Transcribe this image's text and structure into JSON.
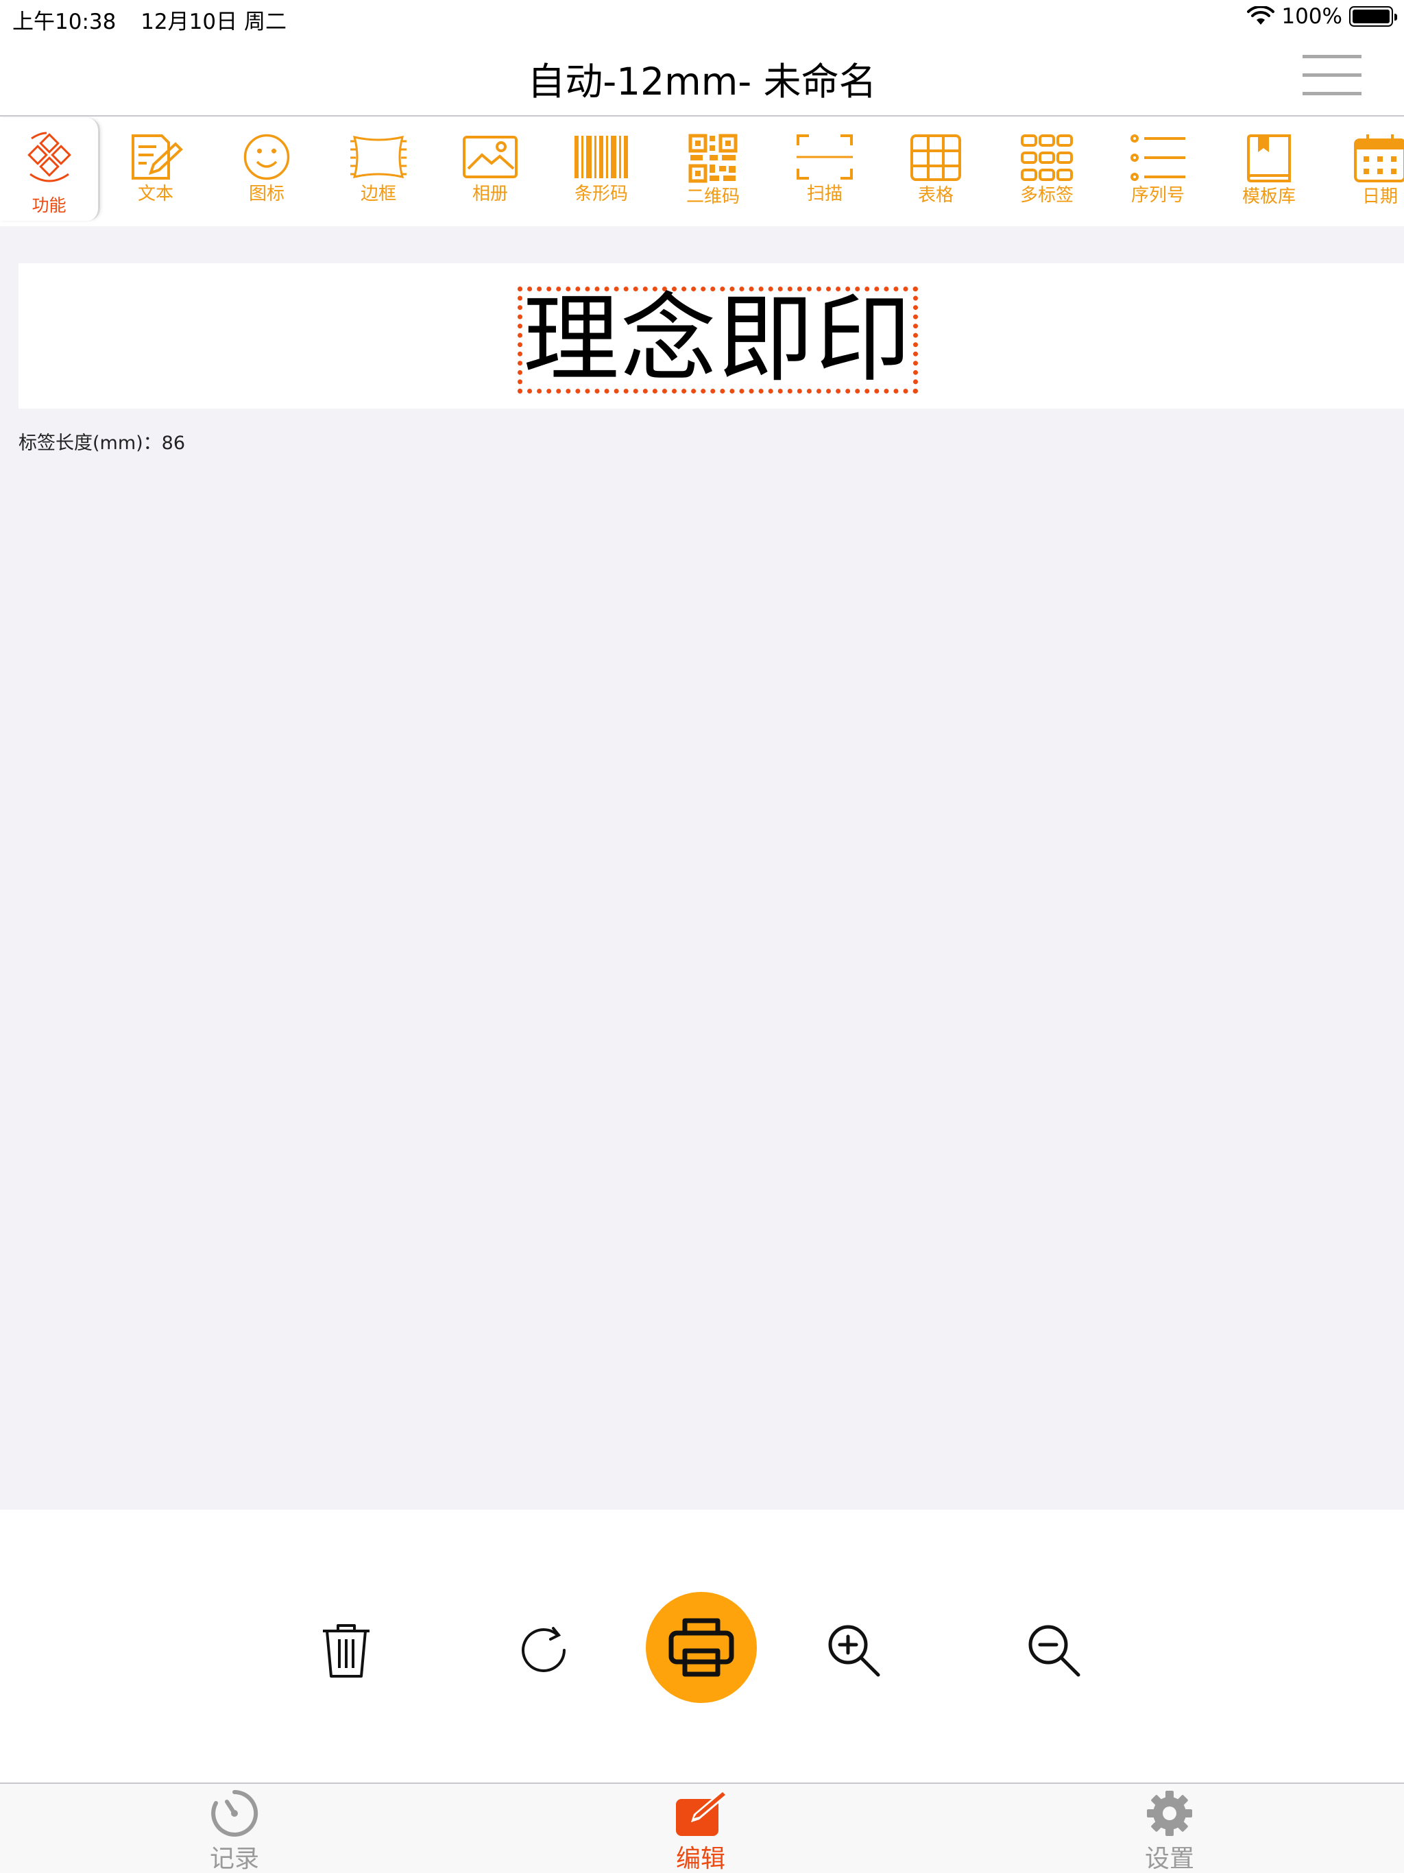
{
  "status_bar": {
    "time": "上午10:38",
    "date": "12月10日 周二",
    "battery": "100%"
  },
  "nav": {
    "title": "自动-12mm- 未命名"
  },
  "toolbar": {
    "function_label": "功能",
    "tools": [
      {
        "label": "文本",
        "icon": "text-edit-icon"
      },
      {
        "label": "图标",
        "icon": "smiley-icon"
      },
      {
        "label": "边框",
        "icon": "border-icon"
      },
      {
        "label": "相册",
        "icon": "photo-icon"
      },
      {
        "label": "条形码",
        "icon": "barcode-icon"
      },
      {
        "label": "二维码",
        "icon": "qrcode-icon"
      },
      {
        "label": "扫描",
        "icon": "scan-icon"
      },
      {
        "label": "表格",
        "icon": "table-icon"
      },
      {
        "label": "多标签",
        "icon": "multi-label-icon"
      },
      {
        "label": "序列号",
        "icon": "serial-number-icon"
      },
      {
        "label": "模板库",
        "icon": "template-icon"
      },
      {
        "label": "日期",
        "icon": "calendar-icon"
      }
    ],
    "accent_color": "#f29a12",
    "function_color": "#ee4b12"
  },
  "canvas": {
    "label_text": "理念即印",
    "length_label": "标签长度(mm)：",
    "length_value": "86"
  },
  "actions": {
    "print_color": "#fea30b"
  },
  "tabs": [
    {
      "label": "记录",
      "icon": "clock-icon",
      "active": false
    },
    {
      "label": "编辑",
      "icon": "edit-icon",
      "active": true
    },
    {
      "label": "设置",
      "icon": "gear-icon",
      "active": false
    }
  ]
}
